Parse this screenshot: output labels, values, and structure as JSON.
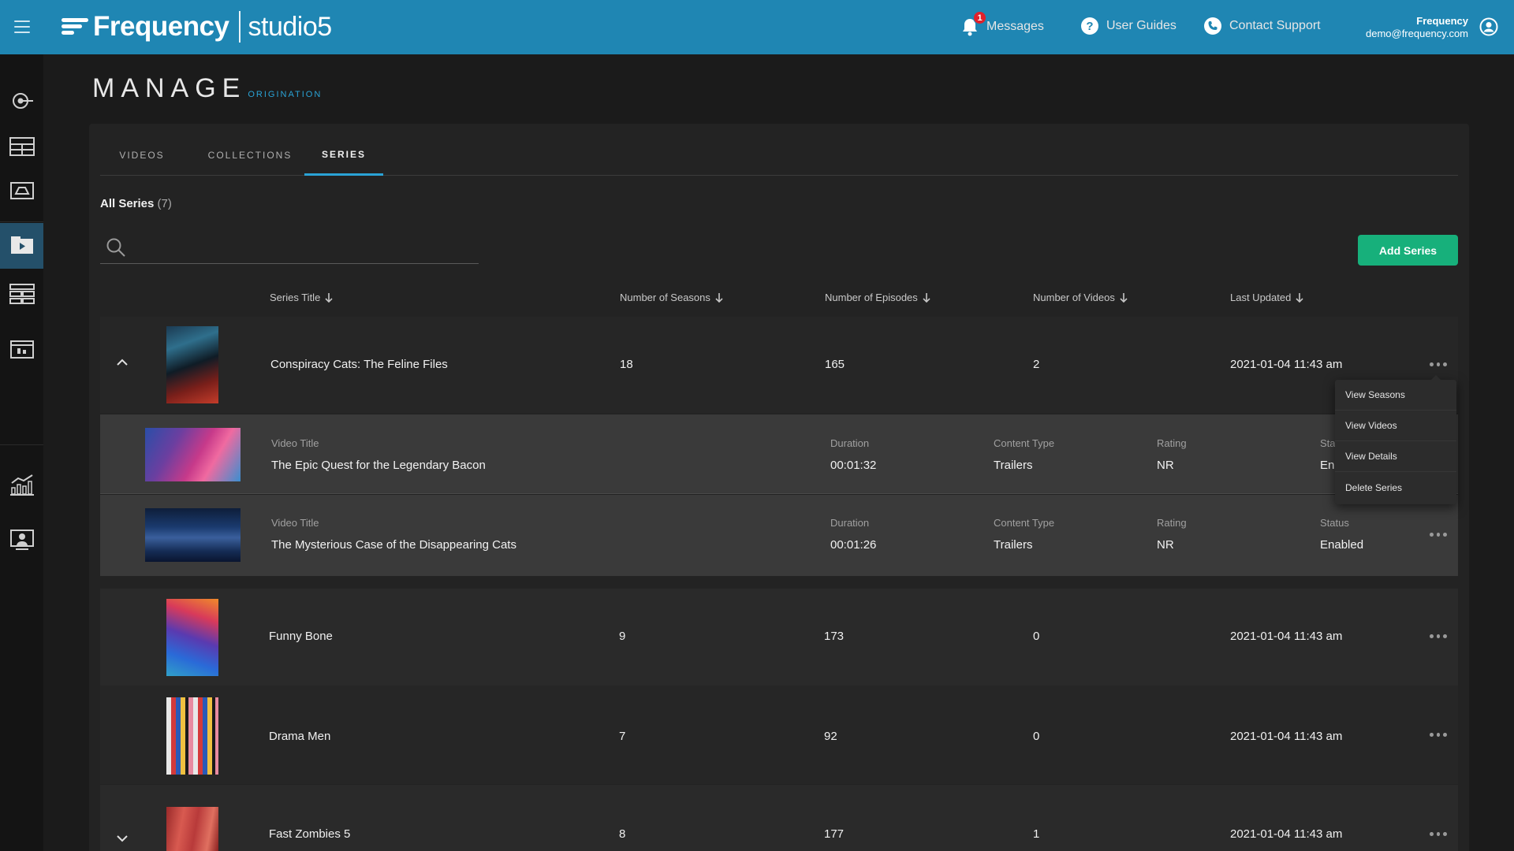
{
  "header": {
    "brand": "Frequency",
    "product": "studio5",
    "messages_label": "Messages",
    "notification_count": "1",
    "user_guides_label": "User Guides",
    "contact_support_label": "Contact Support",
    "user_name": "Frequency",
    "user_email": "demo@frequency.com"
  },
  "page": {
    "title": "MANAGE",
    "subtitle": "ORIGINATION"
  },
  "tabs": [
    {
      "label": "VIDEOS"
    },
    {
      "label": "COLLECTIONS"
    },
    {
      "label": "SERIES"
    }
  ],
  "section": {
    "title": "All Series",
    "count": "(7)"
  },
  "search": {
    "placeholder": ""
  },
  "add_button_label": "Add Series",
  "columns": {
    "series_title": "Series Title",
    "seasons": "Number of Seasons",
    "episodes": "Number of Episodes",
    "videos": "Number of Videos",
    "updated": "Last Updated"
  },
  "series": [
    {
      "title": "Conspiracy Cats: The Feline Files",
      "seasons": "18",
      "episodes": "165",
      "videos": "2",
      "updated": "2021-01-04 11:43 am"
    },
    {
      "title": "Funny Bone",
      "seasons": "9",
      "episodes": "173",
      "videos": "0",
      "updated": "2021-01-04 11:43 am"
    },
    {
      "title": "Drama Men",
      "seasons": "7",
      "episodes": "92",
      "videos": "0",
      "updated": "2021-01-04 11:43 am"
    },
    {
      "title": "Fast Zombies 5",
      "seasons": "8",
      "episodes": "177",
      "videos": "1",
      "updated": "2021-01-04 11:43 am"
    }
  ],
  "sub_labels": {
    "video_title": "Video Title",
    "duration": "Duration",
    "content_type": "Content Type",
    "rating": "Rating",
    "status": "Status",
    "status_truncated": "Sta"
  },
  "videos": [
    {
      "title": "The Epic Quest for the Legendary Bacon",
      "duration": "00:01:32",
      "content_type": "Trailers",
      "rating": "NR",
      "status": "Enabled",
      "status_truncated": "En"
    },
    {
      "title": "The Mysterious Case of the Disappearing Cats",
      "duration": "00:01:26",
      "content_type": "Trailers",
      "rating": "NR",
      "status": "Enabled"
    }
  ],
  "context_menu": [
    {
      "label": "View Seasons"
    },
    {
      "label": "View Videos"
    },
    {
      "label": "View Details"
    },
    {
      "label": "Delete Series"
    }
  ],
  "colors": {
    "topbar": "#1f86b3",
    "accent": "#2aa3d6",
    "primary_button": "#17b07b",
    "badge": "#e0202a"
  }
}
